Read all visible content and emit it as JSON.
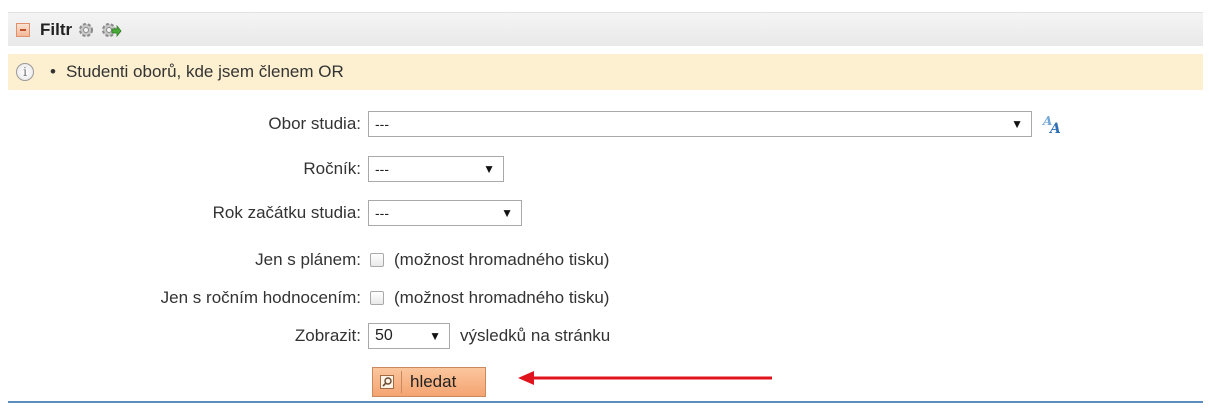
{
  "header": {
    "title": "Filtr"
  },
  "info": {
    "bullet": "•",
    "text": "Studenti oborů, kde jsem členem OR"
  },
  "form": {
    "obor": {
      "label": "Obor studia:",
      "value": "---"
    },
    "rocnik": {
      "label": "Ročník:",
      "value": "---"
    },
    "rok": {
      "label": "Rok začátku studia:",
      "value": "---"
    },
    "plan": {
      "label": "Jen s plánem:",
      "hint": "(možnost hromadného tisku)",
      "checked": false
    },
    "hodnoceni": {
      "label": "Jen s ročním hodnocením:",
      "hint": "(možnost hromadného tisku)",
      "checked": false
    },
    "zobrazit": {
      "label": "Zobrazit:",
      "value": "50",
      "suffix": "výsledků na stránku"
    },
    "search_button": "hledat"
  },
  "colors": {
    "info_bg": "#fdf0d0",
    "button_bg": "#f5a472",
    "arrow": "#e0141c",
    "accent_line": "#5b8dc0"
  },
  "icons": [
    "collapse-icon",
    "gear-icon",
    "gear-arrow-icon",
    "info-icon",
    "translate-icon",
    "magnifier-icon",
    "red-arrow-annotation"
  ]
}
